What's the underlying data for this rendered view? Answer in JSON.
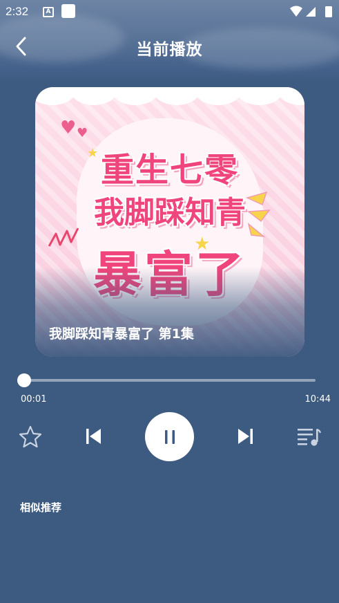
{
  "status_bar": {
    "time": "2:32",
    "notif_letter": "A"
  },
  "header": {
    "title": "当前播放"
  },
  "cover": {
    "line1": "重生七零",
    "line2": "我脚踩知青",
    "line3": "暴富了",
    "caption": "我脚踩知青暴富了 第1集"
  },
  "player": {
    "current_time": "00:01",
    "duration": "10:44",
    "progress": 0.0016,
    "state": "playing"
  },
  "section": {
    "similar_title": "相似推荐"
  },
  "colors": {
    "background": "#3d5a80",
    "cover_text": "#f0457c"
  },
  "icons": [
    "back-arrow-icon",
    "star-icon",
    "skip-previous-icon",
    "pause-icon",
    "skip-next-icon",
    "playlist-icon"
  ]
}
